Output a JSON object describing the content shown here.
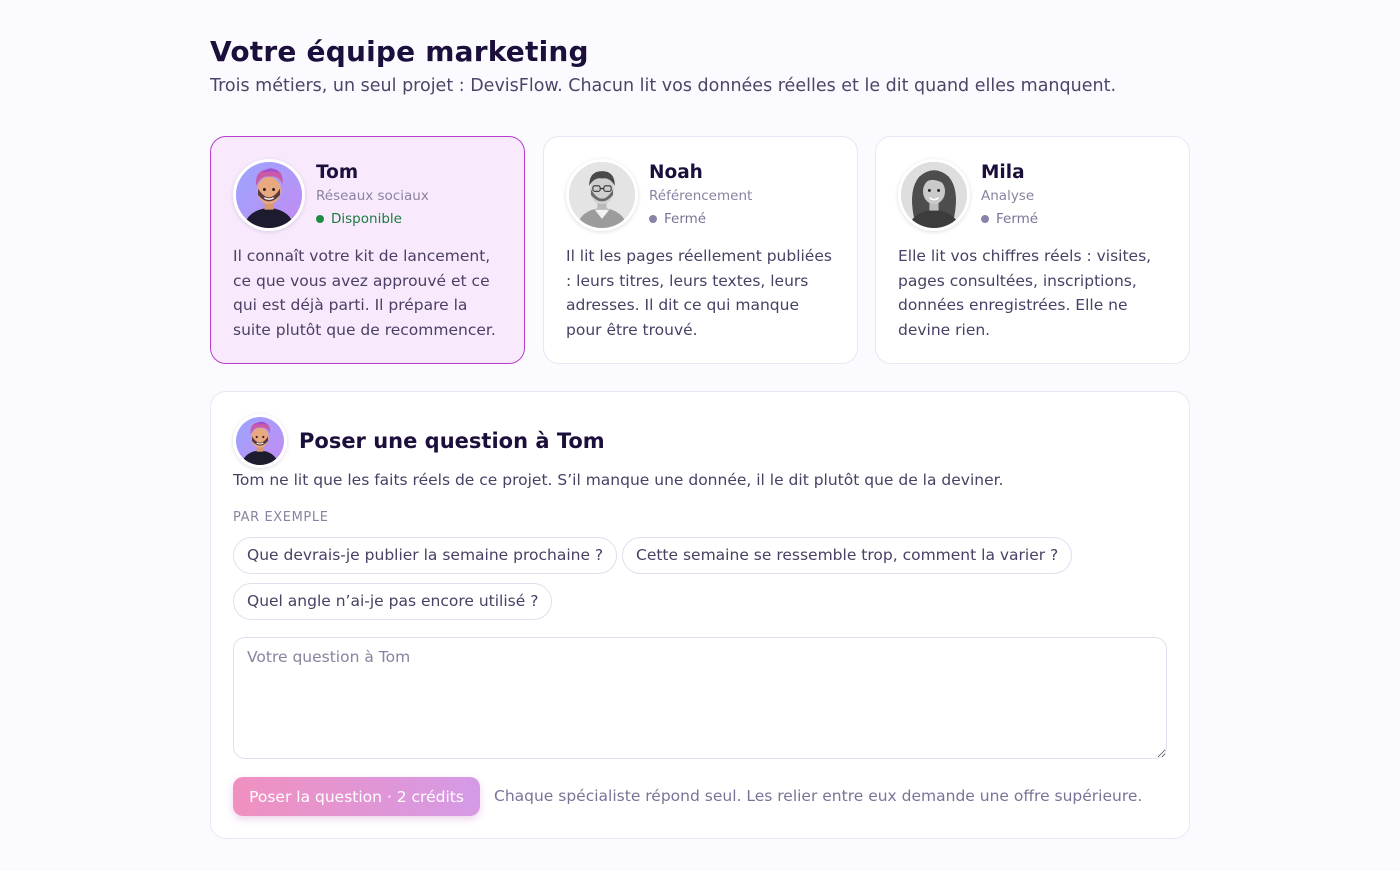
{
  "header": {
    "title": "Votre équipe marketing",
    "subtitle": "Trois métiers, un seul projet : DevisFlow. Chacun lit vos données réelles et le dit quand elles manquent."
  },
  "team": [
    {
      "name": "Tom",
      "role": "Réseaux sociaux",
      "status": "Disponible",
      "description": "Il connaît votre kit de lancement, ce que vous avez approuvé et ce qui est déjà parti. Il prépare la suite plutôt que de recommencer."
    },
    {
      "name": "Noah",
      "role": "Référencement",
      "status": "Fermé",
      "description": "Il lit les pages réellement publiées : leurs titres, leurs textes, leurs adresses. Il dit ce qui manque pour être trouvé."
    },
    {
      "name": "Mila",
      "role": "Analyse",
      "status": "Fermé",
      "description": "Elle lit vos chiffres réels : visites, pages consultées, inscriptions, données enregistrées. Elle ne devine rien."
    }
  ],
  "ask_panel": {
    "title": "Poser une question à Tom",
    "description": "Tom ne lit que les faits réels de ce projet. S’il manque une donnée, il le dit plutôt que de la deviner.",
    "examples_label": "PAR EXEMPLE",
    "examples": [
      "Que devrais-je publier la semaine prochaine ?",
      "Cette semaine se ressemble trop, comment la varier ?",
      "Quel angle n’ai-je pas encore utilisé ?"
    ],
    "input_placeholder": "Votre question à Tom",
    "input_value": "",
    "submit_label": "Poser la question · 2 crédits",
    "footnote": "Chaque spécialiste répond seul. Les relier entre eux demande une offre supérieure."
  },
  "colors": {
    "accent": "#b440c8",
    "active_card_bg": "#f8eafc",
    "status_available": "#1f8a46",
    "status_closed": "#8b82a8",
    "button_gradient_start": "#f090c0",
    "button_gradient_end": "#d59ae6"
  }
}
